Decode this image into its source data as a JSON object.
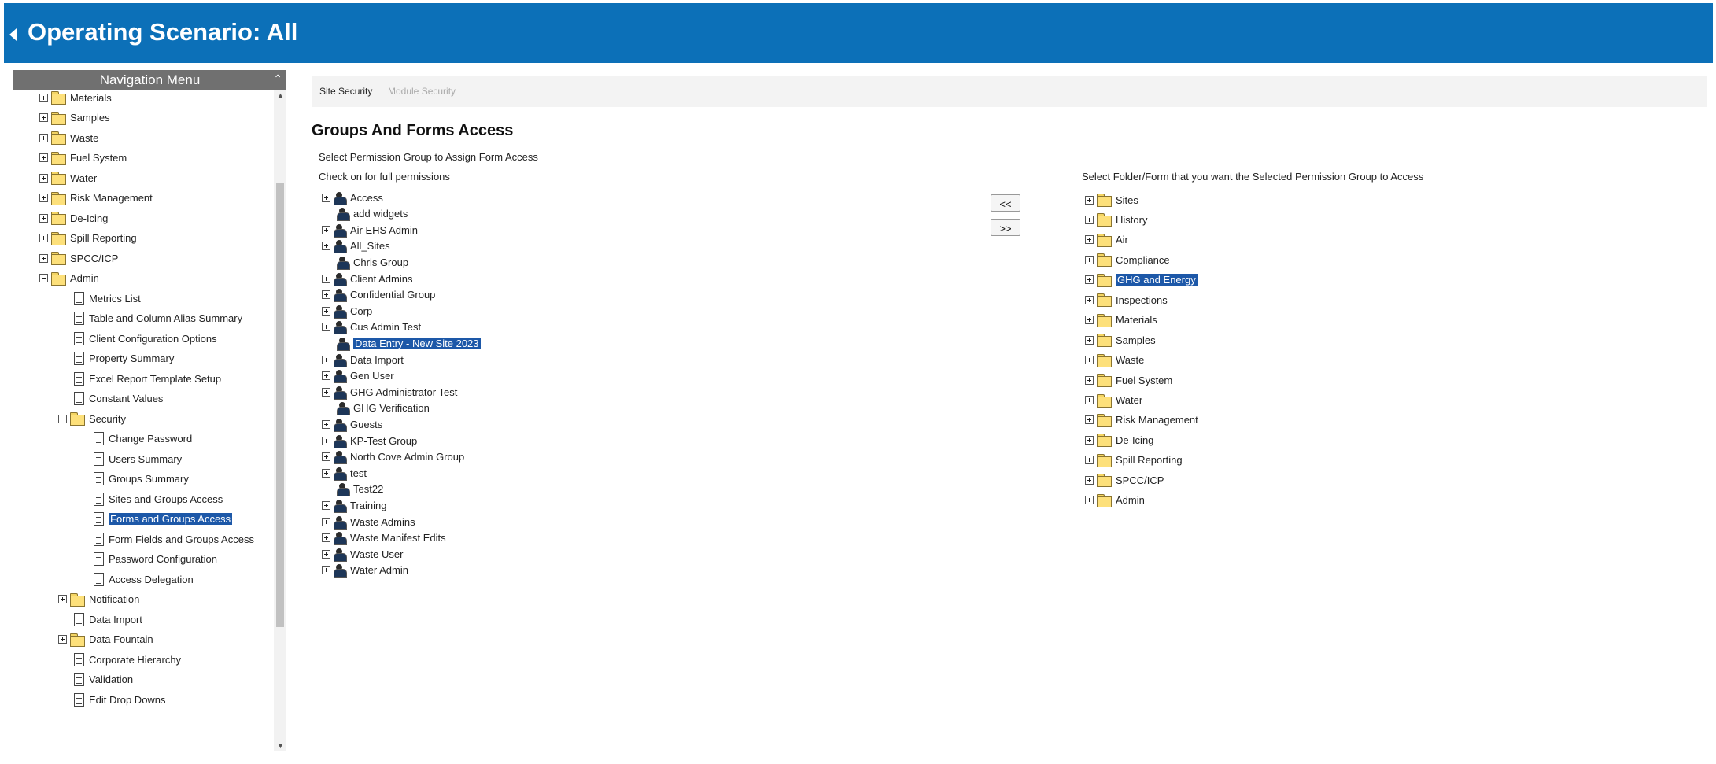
{
  "header": {
    "title": "Operating Scenario: All"
  },
  "nav": {
    "title": "Navigation Menu",
    "items": [
      {
        "label": "Materials",
        "type": "folder",
        "expander": "plus",
        "indent": 0
      },
      {
        "label": "Samples",
        "type": "folder",
        "expander": "plus",
        "indent": 0
      },
      {
        "label": "Waste",
        "type": "folder",
        "expander": "plus",
        "indent": 0
      },
      {
        "label": "Fuel System",
        "type": "folder",
        "expander": "plus",
        "indent": 0
      },
      {
        "label": "Water",
        "type": "folder",
        "expander": "plus",
        "indent": 0
      },
      {
        "label": "Risk Management",
        "type": "folder",
        "expander": "plus",
        "indent": 0
      },
      {
        "label": "De-Icing",
        "type": "folder",
        "expander": "plus",
        "indent": 0
      },
      {
        "label": "Spill Reporting",
        "type": "folder",
        "expander": "plus",
        "indent": 0
      },
      {
        "label": "SPCC/ICP",
        "type": "folder",
        "expander": "plus",
        "indent": 0
      },
      {
        "label": "Admin",
        "type": "folder",
        "expander": "minus",
        "indent": 0
      },
      {
        "label": "Metrics List",
        "type": "doc",
        "indent": 1
      },
      {
        "label": "Table and Column Alias Summary",
        "type": "doc",
        "indent": 1
      },
      {
        "label": "Client Configuration Options",
        "type": "doc",
        "indent": 1
      },
      {
        "label": "Property Summary",
        "type": "doc",
        "indent": 1
      },
      {
        "label": "Excel Report Template Setup",
        "type": "doc",
        "indent": 1
      },
      {
        "label": "Constant Values",
        "type": "doc",
        "indent": 1
      },
      {
        "label": "Security",
        "type": "folder",
        "expander": "minus",
        "indent": 1
      },
      {
        "label": "Change Password",
        "type": "doc",
        "indent": 2
      },
      {
        "label": "Users Summary",
        "type": "doc",
        "indent": 2
      },
      {
        "label": "Groups Summary",
        "type": "doc",
        "indent": 2
      },
      {
        "label": "Sites and Groups Access",
        "type": "doc",
        "indent": 2
      },
      {
        "label": "Forms and Groups Access",
        "type": "doc",
        "indent": 2,
        "selected": true
      },
      {
        "label": "Form Fields and Groups Access",
        "type": "doc",
        "indent": 2
      },
      {
        "label": "Password Configuration",
        "type": "doc",
        "indent": 2
      },
      {
        "label": "Access Delegation",
        "type": "doc",
        "indent": 2
      },
      {
        "label": "Notification",
        "type": "folder",
        "expander": "plus",
        "indent": 1
      },
      {
        "label": "Data Import",
        "type": "doc",
        "indent": 1
      },
      {
        "label": "Data Fountain",
        "type": "folder",
        "expander": "plus",
        "indent": 1
      },
      {
        "label": "Corporate Hierarchy",
        "type": "doc",
        "indent": 1
      },
      {
        "label": "Validation",
        "type": "doc",
        "indent": 1
      },
      {
        "label": "Edit Drop Downs",
        "type": "doc",
        "indent": 1
      }
    ]
  },
  "tabs": [
    {
      "label": "Site Security",
      "active": true
    },
    {
      "label": "Module Security",
      "active": false
    }
  ],
  "main": {
    "title": "Groups And Forms Access",
    "select_group_label": "Select Permission Group to Assign Form Access",
    "check_label": "Check on for full permissions",
    "select_folder_label": "Select Folder/Form that you want the Selected Permission Group to Access",
    "move_left_label": "<<",
    "move_right_label": ">>"
  },
  "groups": [
    {
      "label": "Access",
      "expandable": true
    },
    {
      "label": "add widgets",
      "expandable": false
    },
    {
      "label": "Air EHS Admin",
      "expandable": true
    },
    {
      "label": "All_Sites",
      "expandable": true
    },
    {
      "label": "Chris Group",
      "expandable": false
    },
    {
      "label": "Client Admins",
      "expandable": true
    },
    {
      "label": "Confidential Group",
      "expandable": true
    },
    {
      "label": "Corp",
      "expandable": true
    },
    {
      "label": "Cus Admin Test",
      "expandable": true
    },
    {
      "label": "Data Entry - New Site 2023",
      "expandable": false,
      "selected": true
    },
    {
      "label": "Data Import",
      "expandable": true
    },
    {
      "label": "Gen User",
      "expandable": true
    },
    {
      "label": "GHG Administrator Test",
      "expandable": true
    },
    {
      "label": "GHG Verification",
      "expandable": false
    },
    {
      "label": "Guests",
      "expandable": true
    },
    {
      "label": "KP-Test Group",
      "expandable": true
    },
    {
      "label": "North Cove Admin Group",
      "expandable": true
    },
    {
      "label": "test",
      "expandable": true
    },
    {
      "label": "Test22",
      "expandable": false
    },
    {
      "label": "Training",
      "expandable": true
    },
    {
      "label": "Waste Admins",
      "expandable": true
    },
    {
      "label": "Waste Manifest Edits",
      "expandable": true
    },
    {
      "label": "Waste User",
      "expandable": true
    },
    {
      "label": "Water Admin",
      "expandable": true
    }
  ],
  "folders": [
    {
      "label": "Sites"
    },
    {
      "label": "History"
    },
    {
      "label": "Air"
    },
    {
      "label": "Compliance"
    },
    {
      "label": "GHG and Energy",
      "selected": true
    },
    {
      "label": "Inspections"
    },
    {
      "label": "Materials"
    },
    {
      "label": "Samples"
    },
    {
      "label": "Waste"
    },
    {
      "label": "Fuel System"
    },
    {
      "label": "Water"
    },
    {
      "label": "Risk Management"
    },
    {
      "label": "De-Icing"
    },
    {
      "label": "Spill Reporting"
    },
    {
      "label": "SPCC/ICP"
    },
    {
      "label": "Admin"
    }
  ]
}
